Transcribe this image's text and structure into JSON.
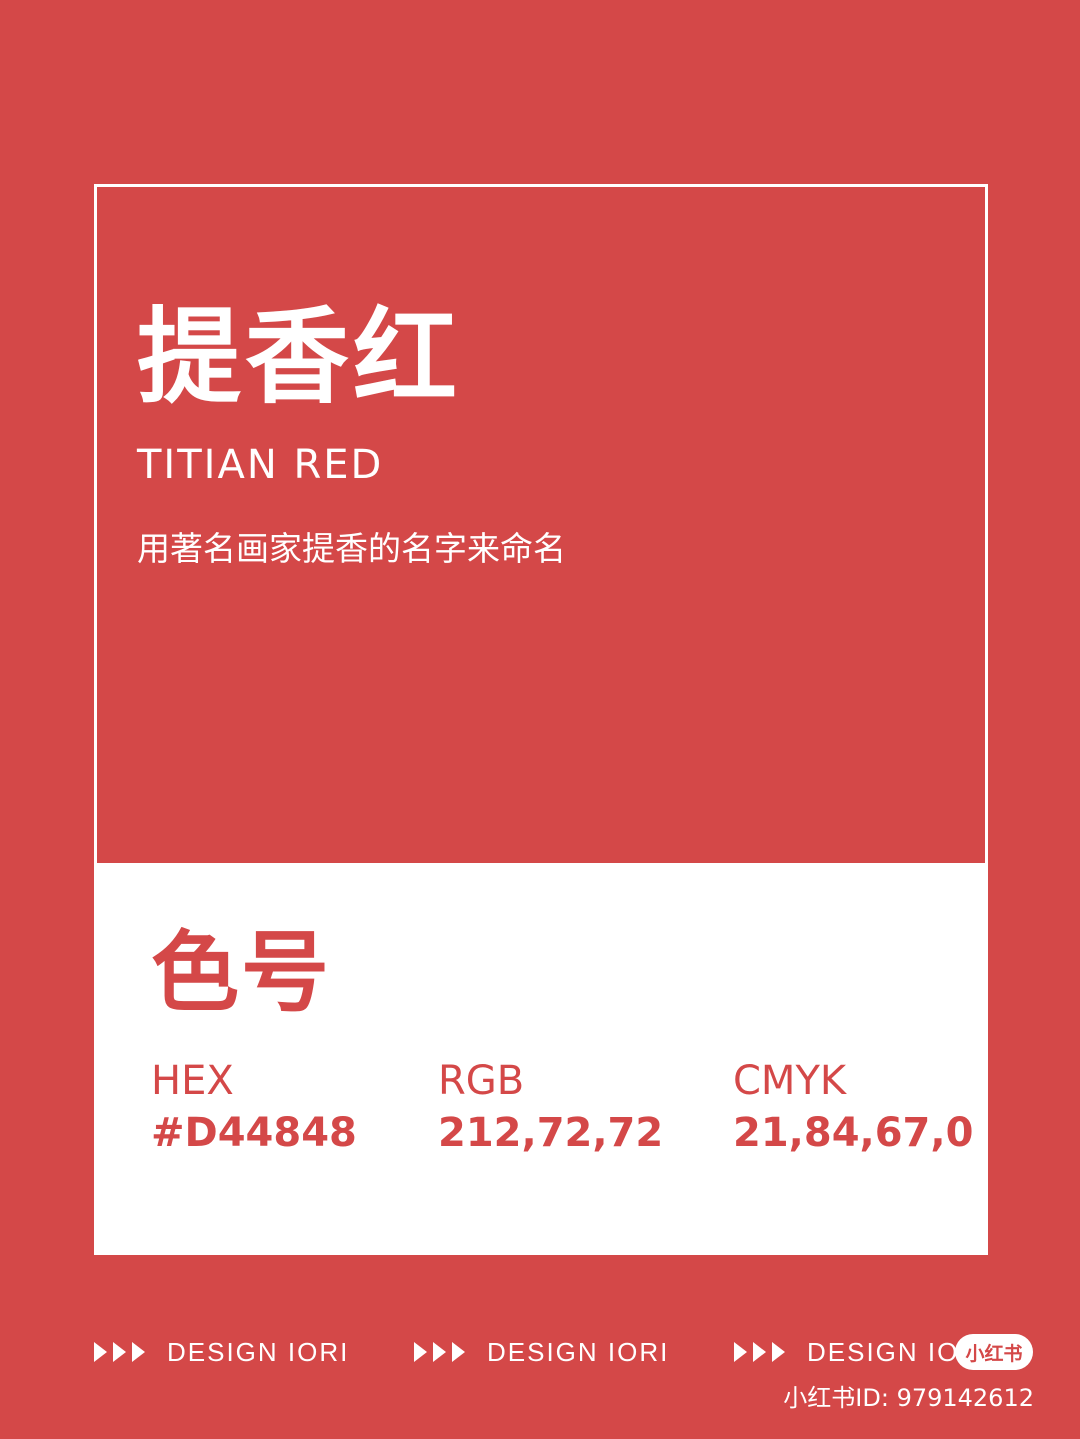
{
  "colors": {
    "background": "#D44848",
    "panel": "#FFFFFF",
    "accent": "#D44848"
  },
  "swatch": {
    "name_cn": "提香红",
    "name_en": "TITIAN RED",
    "description": "用著名画家提香的名字来命名"
  },
  "info": {
    "heading": "色号",
    "codes": [
      {
        "label": "HEX",
        "value": "#D44848"
      },
      {
        "label": "RGB",
        "value": "212,72,72"
      },
      {
        "label": "CMYK",
        "value": "21,84,67,0"
      }
    ]
  },
  "footer": {
    "items": [
      "DESIGN IORI",
      "DESIGN IORI",
      "DESIGN IO"
    ],
    "arrow_icon": "triple-arrow-icon"
  },
  "watermark": {
    "badge": "小红书",
    "id_text": "小红书ID: 979142612"
  }
}
